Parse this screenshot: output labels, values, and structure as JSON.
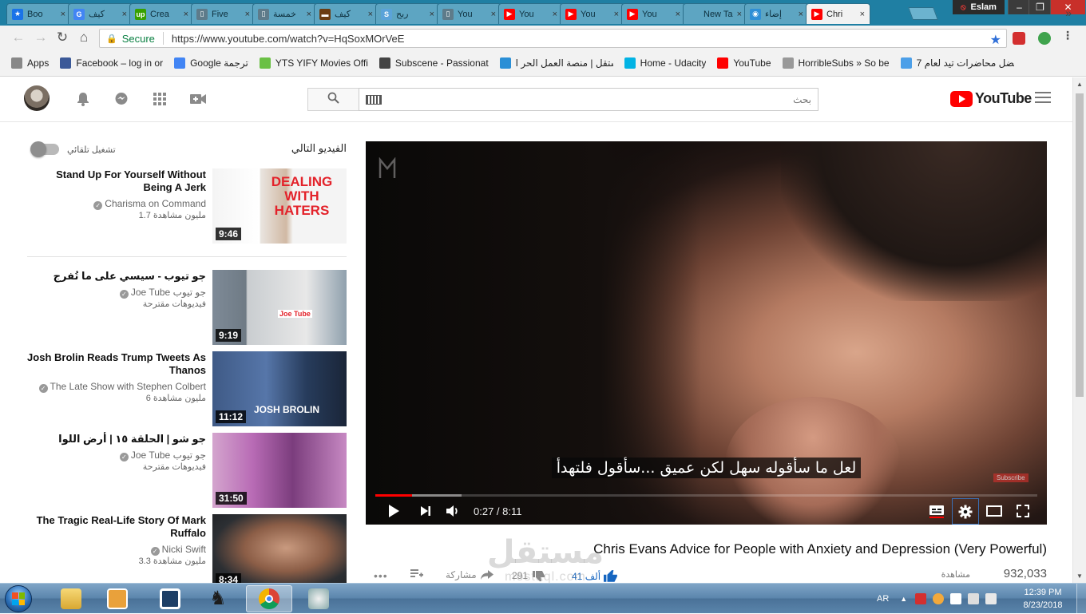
{
  "browser": {
    "tabs": [
      {
        "title": "Boo",
        "fav": "★",
        "color": "#1a73e8",
        "active": false
      },
      {
        "title": "كيف",
        "fav": "G",
        "color": "#4285f4",
        "active": false
      },
      {
        "title": "Crea",
        "fav": "up",
        "color": "#37a000",
        "active": false
      },
      {
        "title": "Five",
        "fav": "▯",
        "color": "#5e7b8a",
        "active": false
      },
      {
        "title": "خمسة",
        "fav": "▯",
        "color": "#5e7b8a",
        "active": false
      },
      {
        "title": "كيف",
        "fav": "▬",
        "color": "#6b3d12",
        "active": false
      },
      {
        "title": "ربح",
        "fav": "S",
        "color": "#5ba3d9",
        "active": false
      },
      {
        "title": "You",
        "fav": "▯",
        "color": "#5e7b8a",
        "active": false
      },
      {
        "title": "You",
        "fav": "▶",
        "color": "#ff0000",
        "active": false
      },
      {
        "title": "You",
        "fav": "▶",
        "color": "#ff0000",
        "active": false
      },
      {
        "title": "You",
        "fav": "▶",
        "color": "#ff0000",
        "active": false
      },
      {
        "title": "New Ta",
        "fav": "",
        "color": "transparent",
        "active": false
      },
      {
        "title": "إضاء",
        "fav": "◉",
        "color": "#2f8fd6",
        "active": false
      },
      {
        "title": "Chri",
        "fav": "▶",
        "color": "#ff0000",
        "active": true
      }
    ],
    "tab_close": "×",
    "profile_name": "Eslam",
    "window_min": "‒",
    "window_restore": "❐",
    "window_close": "✕",
    "back": "←",
    "forward": "→",
    "reload": "↻",
    "home": "⌂",
    "secure_label": "Secure",
    "url": "https://www.youtube.com/watch?v=HqSoxMOrVeE",
    "bookmark_star": "★",
    "bookmarks": [
      {
        "label": "Apps",
        "icon": "apps",
        "color": "#888"
      },
      {
        "label": "Facebook – log in or",
        "icon": "f",
        "color": "#3b5998"
      },
      {
        "label": "Google ترجمة",
        "icon": "G",
        "color": "#4285f4"
      },
      {
        "label": "YTS YIFY Movies Offi",
        "icon": "yts",
        "color": "#6ac045"
      },
      {
        "label": "Subscene - Passionat",
        "icon": "S",
        "color": "#444"
      },
      {
        "label": "مستقل | منصة العمل الحر ا",
        "icon": "m",
        "color": "#2a8fd6"
      },
      {
        "label": "Home - Udacity",
        "icon": "U",
        "color": "#02b3e4"
      },
      {
        "label": "YouTube",
        "icon": "▶",
        "color": "#ff0000"
      },
      {
        "label": "HorribleSubs » So be",
        "icon": "H",
        "color": "#999"
      },
      {
        "label": "أفضل محاضرات تيد لعام 7",
        "icon": "g",
        "color": "#4c9fe8"
      }
    ],
    "bookmarks_more": "»"
  },
  "youtube": {
    "search_placeholder": "بحث",
    "search_icon": "⌕",
    "logo_text": "YouTube",
    "header_icons": [
      "bell-icon",
      "chat-icon",
      "apps-grid-icon",
      "upload-video-icon"
    ],
    "up_next_label": "الفيديو التالي",
    "autoplay_label": "تشغيل تلقائي",
    "autoplay_on": false,
    "up_next": [
      {
        "title": "Stand Up For Yourself Without Being A Jerk",
        "channel": "Charisma on Command",
        "views": "1.7 مليون مشاهدة",
        "duration": "9:46",
        "thumb_text": "DEALING WITH HATERS"
      },
      {
        "title": "جو تيوب - سيسي على ما تُفرج",
        "channel": "Joe Tube جو تيوب",
        "views": "فيديوهات مقترحة",
        "duration": "9:19",
        "thumb_text": "Joe Tube"
      },
      {
        "title": "Josh Brolin Reads Trump Tweets As Thanos",
        "channel": "The Late Show with Stephen Colbert",
        "views": "6 مليون مشاهدة",
        "duration": "11:12",
        "thumb_text": "JOSH BROLIN"
      },
      {
        "title": "جو شو | الحلقة ١٥ | أرض اللوا",
        "channel": "Joe Tube جو تيوب",
        "views": "فيديوهات مقترحة",
        "duration": "31:50",
        "thumb_text": ""
      },
      {
        "title": "The Tragic Real-Life Story Of Mark Ruffalo",
        "channel": "Nicki Swift",
        "views": "3.3 مليون مشاهدة",
        "duration": "8:34",
        "thumb_text": ""
      }
    ],
    "player": {
      "subtitle": "لعل ما سأقوله سهل لكن عميق ...سأقول فلتهدأ",
      "subscribe_watermark": "Subscribe",
      "time": "0:27 / 8:11",
      "progress_played": 0.055,
      "progress_buffered": 0.13
    },
    "video": {
      "title": "Chris Evans Advice for People with Anxiety and Depression (Very Powerful)",
      "views": "932,033",
      "views_label": "مشاهدة",
      "likes": "41 ألف",
      "dislikes": "291",
      "share_label": "مشاركة",
      "more": "•••"
    }
  },
  "watermark": {
    "arabic": "مستقل",
    "latin": "mostaql.com"
  },
  "taskbar": {
    "language": "AR",
    "time": "12:39 PM",
    "date": "8/23/2018"
  }
}
